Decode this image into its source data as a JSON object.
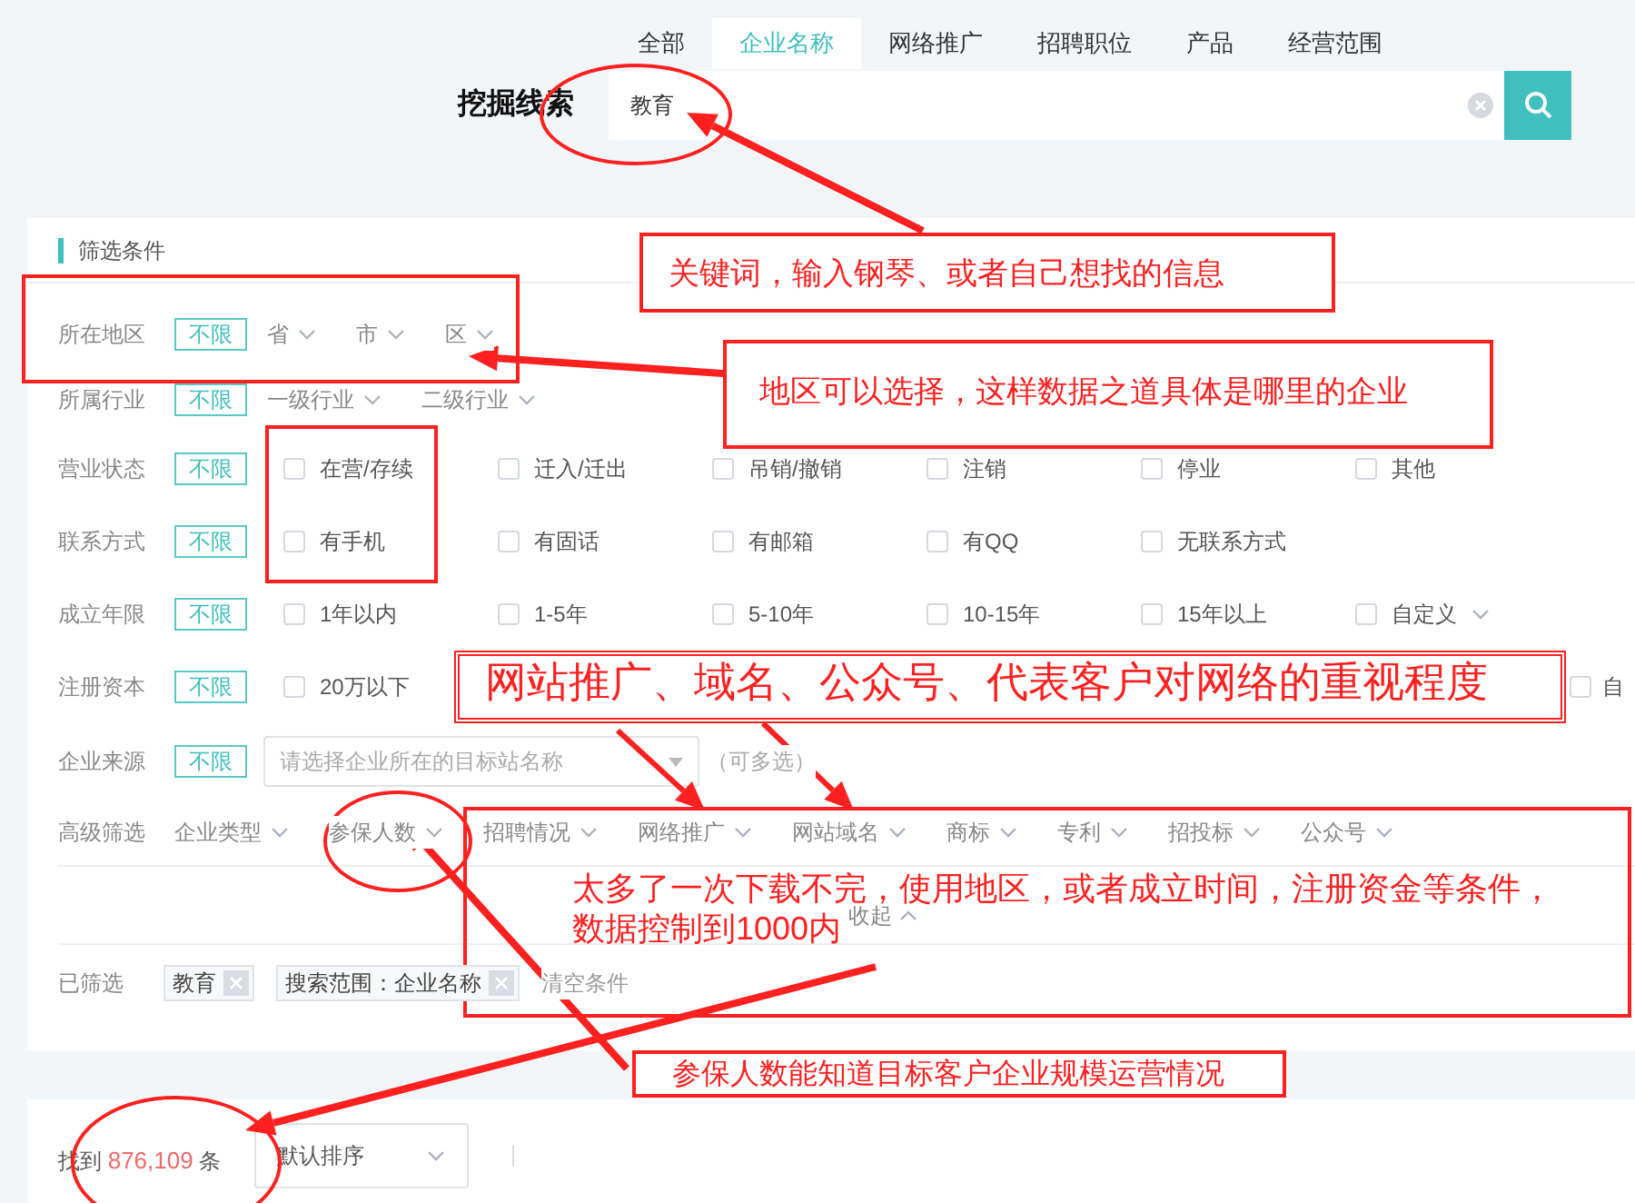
{
  "tabs": [
    {
      "label": "全部",
      "selected": false
    },
    {
      "label": "企业名称",
      "selected": true
    },
    {
      "label": "网络推广",
      "selected": false
    },
    {
      "label": "招聘职位",
      "selected": false
    },
    {
      "label": "产品",
      "selected": false
    },
    {
      "label": "经营范围",
      "selected": false
    }
  ],
  "search": {
    "label": "挖掘线索",
    "value": "教育"
  },
  "filter_panel": {
    "title": "筛选条件",
    "rows": [
      {
        "kind": "dropdowns",
        "label": "所在地区",
        "any": "不限",
        "options": [
          "省",
          "市",
          "区"
        ]
      },
      {
        "kind": "dropdowns",
        "label": "所属行业",
        "any": "不限",
        "options": [
          "一级行业",
          "二级行业"
        ]
      },
      {
        "kind": "checks",
        "label": "营业状态",
        "any": "不限",
        "options": [
          {
            "label": "在营/存续",
            "checked": false
          },
          {
            "label": "迁入/迁出",
            "checked": false
          },
          {
            "label": "吊销/撤销",
            "checked": false
          },
          {
            "label": "注销",
            "checked": false
          },
          {
            "label": "停业",
            "checked": false
          },
          {
            "label": "其他",
            "checked": false
          }
        ]
      },
      {
        "kind": "checks",
        "label": "联系方式",
        "any": "不限",
        "options": [
          {
            "label": "有手机",
            "checked": false
          },
          {
            "label": "有固话",
            "checked": false
          },
          {
            "label": "有邮箱",
            "checked": false
          },
          {
            "label": "有QQ",
            "checked": false
          },
          {
            "label": "无联系方式",
            "checked": false
          }
        ]
      },
      {
        "kind": "checks",
        "label": "成立年限",
        "any": "不限",
        "options": [
          {
            "label": "1年以内",
            "checked": false
          },
          {
            "label": "1-5年",
            "checked": false
          },
          {
            "label": "5-10年",
            "checked": false
          },
          {
            "label": "10-15年",
            "checked": false
          },
          {
            "label": "15年以上",
            "checked": false
          },
          {
            "label": "自定义",
            "checked": false,
            "has_menu": true
          }
        ]
      },
      {
        "kind": "checks",
        "label": "注册资本",
        "any": "不限",
        "options": [
          {
            "label": "20万以下",
            "checked": false
          }
        ],
        "trailing_option": {
          "label": "自",
          "checked": false
        }
      },
      {
        "kind": "select",
        "label": "企业来源",
        "any": "不限",
        "placeholder": "请选择企业所在的目标站名称",
        "note": "（可多选）"
      },
      {
        "kind": "dropdowns",
        "label": "高级筛选",
        "options": [
          "企业类型",
          "参保人数",
          "招聘情况",
          "网络推广",
          "网站域名",
          "商标",
          "专利",
          "招投标",
          "公众号"
        ]
      }
    ],
    "collapse": "收起",
    "applied": {
      "label": "已筛选",
      "tags": [
        "教育",
        "搜索范围：企业名称"
      ],
      "clear": "清空条件"
    }
  },
  "results": {
    "prefix": "找到",
    "count": "876,109",
    "suffix": "条",
    "sort": "默认排序"
  },
  "annotations": [
    {
      "lines": [
        "关键词，输入钢琴、或者自己想找的信息"
      ]
    },
    {
      "lines": [
        "地区可以选择，这样数据之道具体是哪里的企业"
      ]
    },
    {
      "lines": [
        "网站推广、域名、公众号、代表客户对网络的重视程度"
      ]
    },
    {
      "lines": [
        "太多了一次下载不完，使用地区，或者成立时间，注册资金等条件，",
        "数据控制到1000内"
      ]
    },
    {
      "lines": [
        "参保人数能知道目标客户企业规模运营情况"
      ]
    }
  ]
}
